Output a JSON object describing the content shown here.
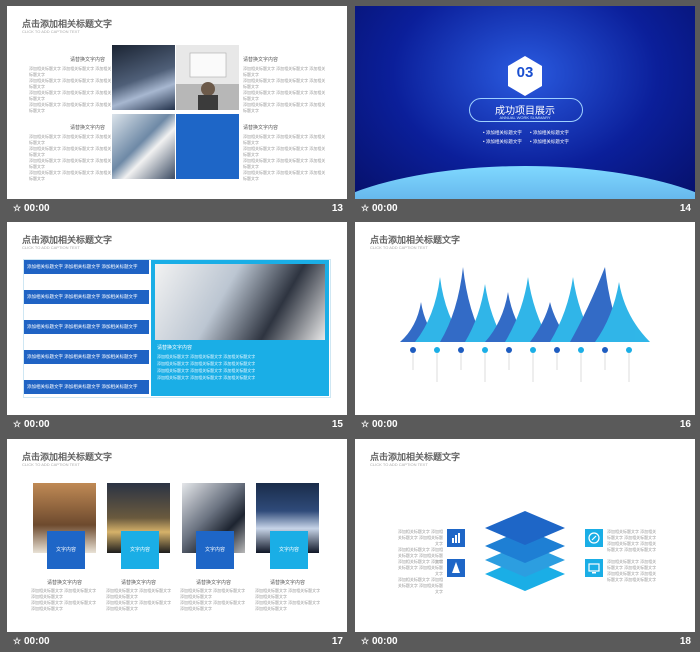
{
  "common": {
    "title": "点击添加相关标题文字",
    "subtitle": "CLICK TO ADD CAPTION TEXT",
    "time": "00:00",
    "placeholder_line": "添加相关标题文字 添加相关标题文字 添加相关标题文字",
    "heading_small": "请替换文字内容"
  },
  "slides": [
    {
      "number": "13"
    },
    {
      "number": "14",
      "badge": "03",
      "main_title": "成功项目展示",
      "sub_title": "ANNUAL WORK SUMMARY",
      "bullets": [
        "添加相关标题文字",
        "添加相关标题文字",
        "添加相关标题文字",
        "添加相关标题文字"
      ]
    },
    {
      "number": "15",
      "side_label": "请替换文字内容"
    },
    {
      "number": "16"
    },
    {
      "number": "17",
      "box_label": "文字内容"
    },
    {
      "number": "18"
    }
  ],
  "colors": {
    "blue": "#1e5fbf",
    "cyan": "#1aaee6",
    "dark_bg": "#5a5a5a"
  }
}
